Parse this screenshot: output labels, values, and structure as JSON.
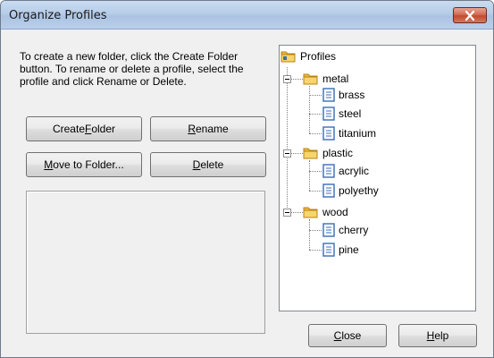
{
  "window": {
    "title": "Organize Profiles"
  },
  "instructions": "To create a new folder, click the Create Folder button. To rename or delete a profile, select the profile and click Rename or Delete.",
  "buttons": {
    "create_folder": {
      "pre": "Create ",
      "accel": "F",
      "post": "older"
    },
    "rename": {
      "pre": "",
      "accel": "R",
      "post": "ename"
    },
    "move_to_folder": {
      "pre": "",
      "accel": "M",
      "post": "ove to Folder..."
    },
    "delete": {
      "pre": "",
      "accel": "D",
      "post": "elete"
    },
    "close": {
      "pre": "",
      "accel": "C",
      "post": "lose"
    },
    "help": {
      "pre": "",
      "accel": "H",
      "post": "elp"
    }
  },
  "tree": {
    "root": "Profiles",
    "folders": [
      {
        "label": "metal",
        "items": [
          "brass",
          "steel",
          "titanium"
        ]
      },
      {
        "label": "plastic",
        "items": [
          "acrylic",
          "polyethy"
        ]
      },
      {
        "label": "wood",
        "items": [
          "cherry",
          "pine"
        ]
      }
    ]
  },
  "icons": {
    "root": "profiles-folder-icon",
    "folder": "folder-icon",
    "profile": "profile-document-icon",
    "collapse": "collapse-minus-icon",
    "close": "close-x-icon"
  },
  "colors": {
    "close_button": "#c7452c",
    "folder": "#f4c542",
    "document_border": "#3a6db5"
  }
}
